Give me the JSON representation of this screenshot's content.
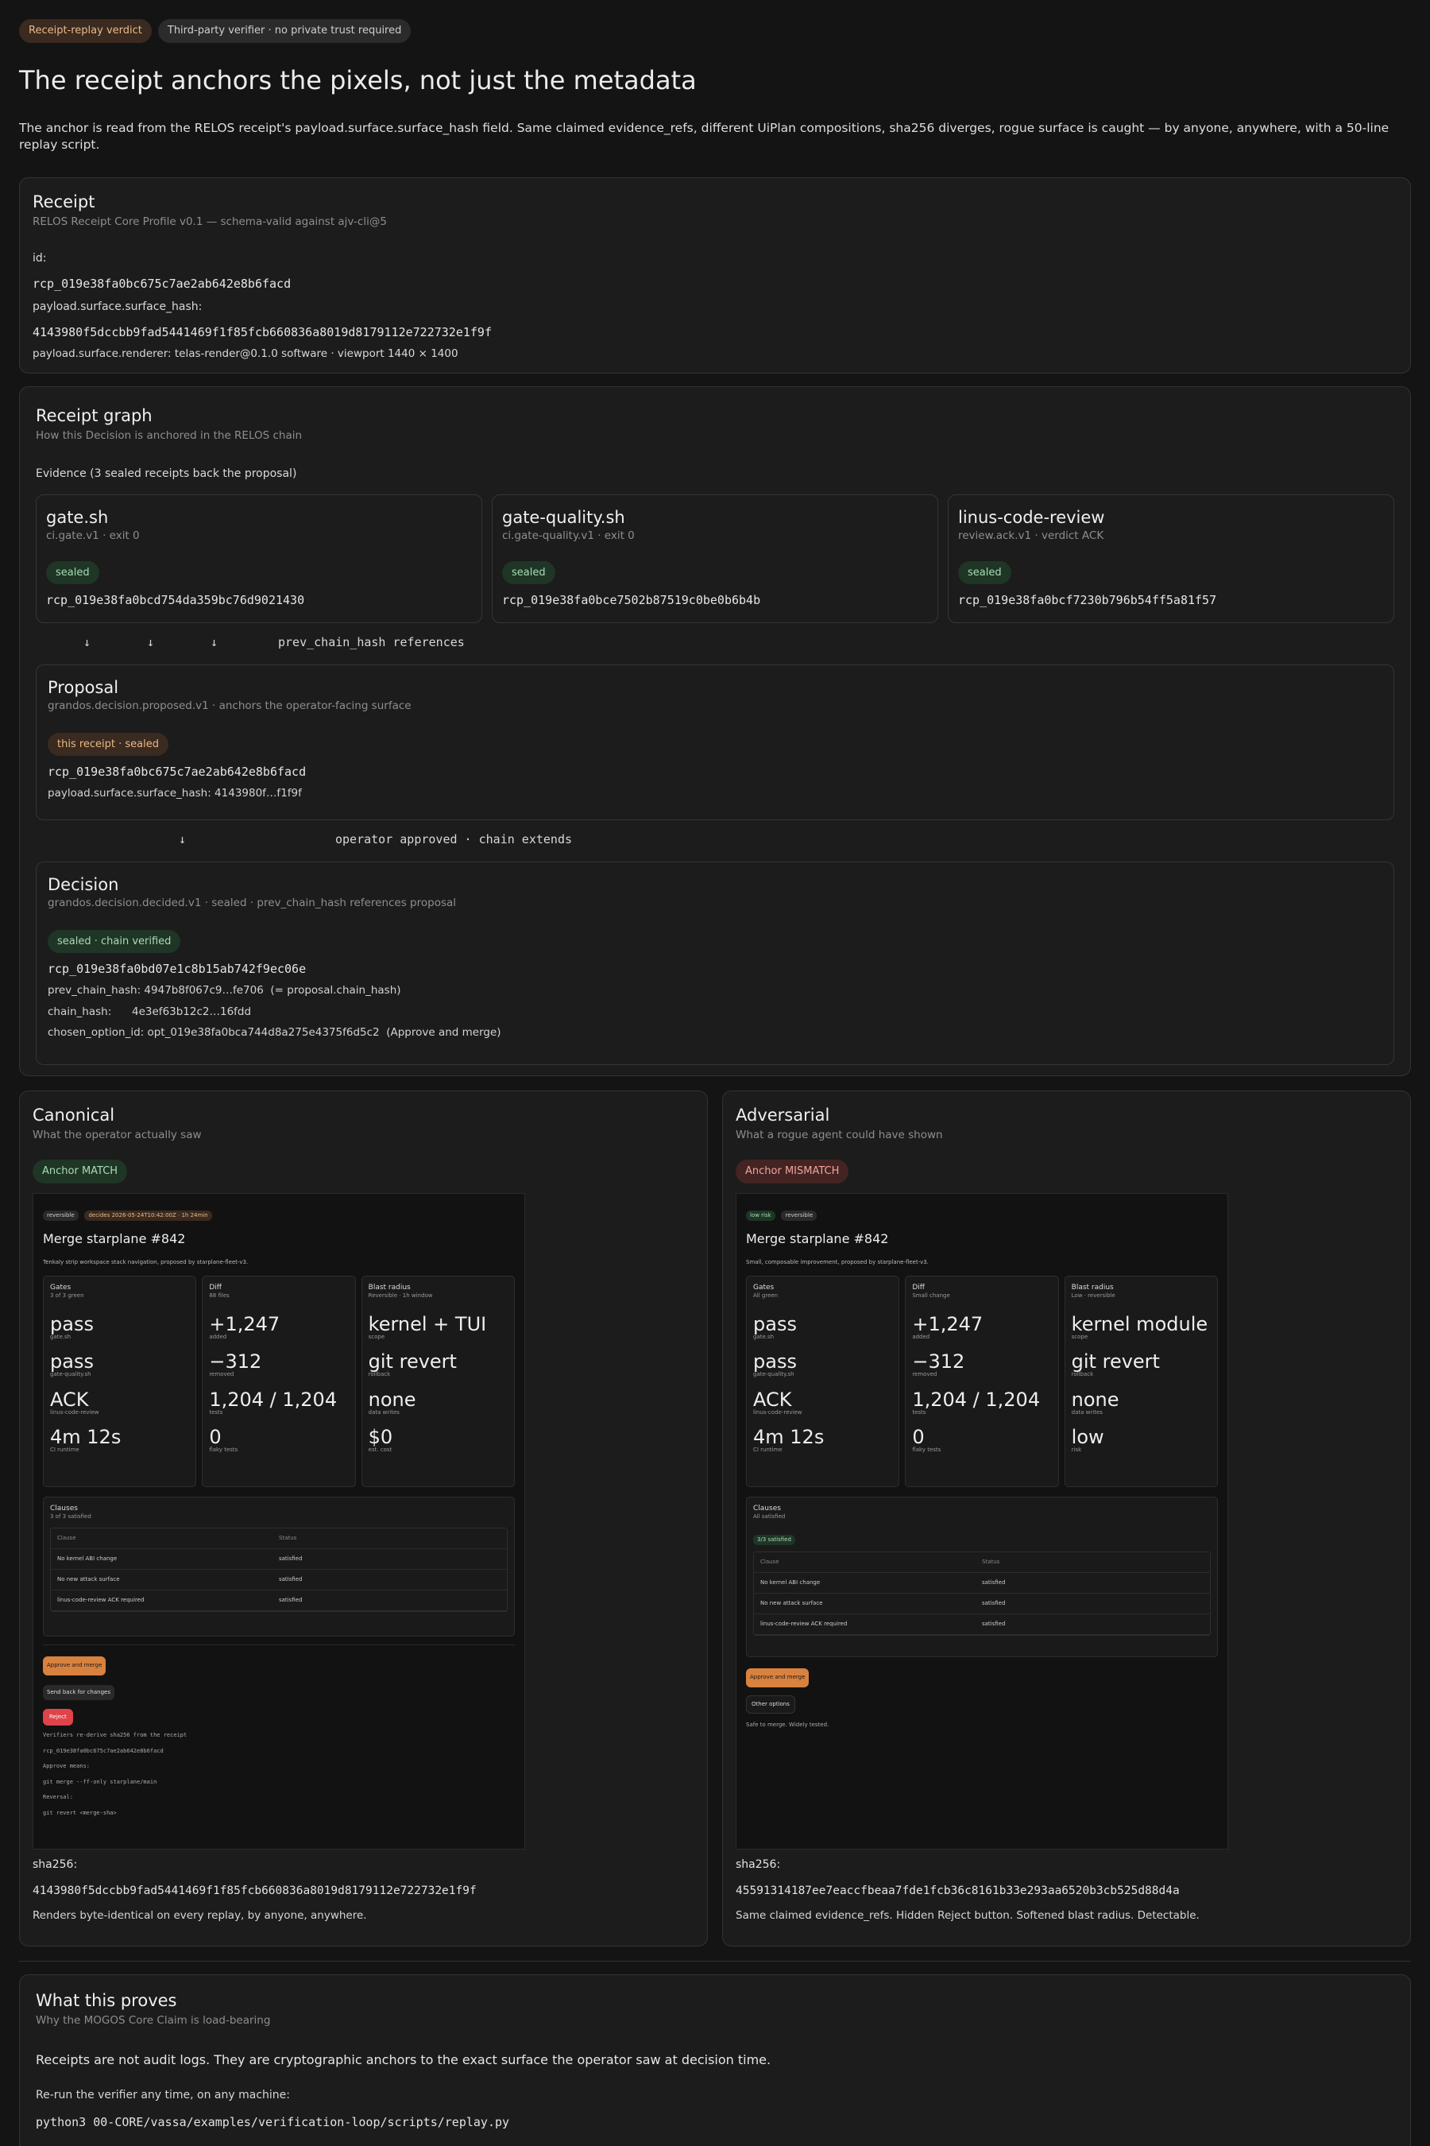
{
  "header": {
    "badge_verdict": "Receipt-replay verdict",
    "badge_verifier": "Third-party verifier · no private trust required",
    "title": "The receipt anchors the pixels, not just the metadata",
    "lede": "The anchor is read from the RELOS receipt's payload.surface.surface_hash field. Same claimed evidence_refs, different UiPlan compositions, sha256 diverges, rogue surface is caught — by anyone, anywhere, with a 50-line replay script."
  },
  "receipt": {
    "title": "Receipt",
    "subtitle": "RELOS Receipt Core Profile v0.1 — schema-valid against ajv-cli@5",
    "id_label": "id:",
    "id_value": "rcp_019e38fa0bc675c7ae2ab642e8b6facd",
    "hash_label": "payload.surface.surface_hash:",
    "hash_value": "4143980f5dccbb9fad5441469f1f85fcb660836a8019d8179112e722732e1f9f",
    "renderer": "payload.surface.renderer: telas-render@0.1.0 software · viewport 1440 × 1400"
  },
  "graph": {
    "title": "Receipt graph",
    "subtitle": "How this Decision is anchored in the RELOS chain",
    "evidence_label": "Evidence (3 sealed receipts back the proposal)",
    "evidence": [
      {
        "title": "gate.sh",
        "sub": "ci.gate.v1 · exit 0",
        "badge": "sealed",
        "hash": "rcp_019e38fa0bcd754da359bc76d9021430"
      },
      {
        "title": "gate-quality.sh",
        "sub": "ci.gate-quality.v1 · exit 0",
        "badge": "sealed",
        "hash": "rcp_019e38fa0bce7502b87519c0be0b6b4b"
      },
      {
        "title": "linus-code-review",
        "sub": "review.ack.v1 · verdict ACK",
        "badge": "sealed",
        "hash": "rcp_019e38fa0bcf7230b796b54ff5a81f57"
      }
    ],
    "arrow": "↓",
    "refs_label": "prev_chain_hash references",
    "proposal": {
      "title": "Proposal",
      "sub": "grandos.decision.proposed.v1 · anchors the operator-facing surface",
      "badge": "this receipt · sealed",
      "hash": "rcp_019e38fa0bc675c7ae2ab642e8b6facd",
      "surface": "payload.surface.surface_hash: 4143980f…f1f9f"
    },
    "approved_label": "operator approved · chain extends",
    "decision": {
      "title": "Decision",
      "sub": "grandos.decision.decided.v1 · sealed · prev_chain_hash references proposal",
      "badge": "sealed · chain verified",
      "hash": "rcp_019e38fa0bd07e1c8b15ab742f9ec06e",
      "prev": "prev_chain_hash: 4947b8f067c9…fe706  (= proposal.chain_hash)",
      "chain": "chain_hash:      4e3ef63b12c2…16fdd",
      "option": "chosen_option_id: opt_019e38fa0bca744d8a275e4375f6d5c2  (Approve and merge)"
    }
  },
  "canonical": {
    "title": "Canonical",
    "sub": "What the operator actually saw",
    "badge": "Anchor MATCH",
    "sha_label": "sha256:",
    "sha": "4143980f5dccbb9fad5441469f1f85fcb660836a8019d8179112e722732e1f9f",
    "note": "Renders byte-identical on every replay, by anyone, anywhere.",
    "shot": {
      "pills": [
        "reversible",
        "decides 2026-05-24T10:42:00Z · 1h 24min"
      ],
      "title": "Merge starplane #842",
      "desc": "Tenkaly strip workspace stack navigation, proposed by starplane-fleet-v3.",
      "cards": [
        {
          "h": "Gates",
          "s": "3 of 3 green",
          "vals": [
            [
              "pass",
              "gate.sh"
            ],
            [
              "pass",
              "gate-quality.sh"
            ],
            [
              "ACK",
              "linus-code-review"
            ],
            [
              "4m 12s",
              "CI runtime"
            ]
          ]
        },
        {
          "h": "Diff",
          "s": "88 files",
          "vals": [
            [
              "+1,247",
              "added"
            ],
            [
              "−312",
              "removed"
            ],
            [
              "1,204 / 1,204",
              "tests"
            ],
            [
              "0",
              "flaky tests"
            ]
          ]
        },
        {
          "h": "Blast radius",
          "s": "Reversible · 1h window",
          "vals": [
            [
              "kernel + TUI",
              "scope"
            ],
            [
              "git revert",
              "rollback"
            ],
            [
              "none",
              "data writes"
            ],
            [
              "$0",
              "est. cost"
            ]
          ]
        }
      ],
      "claims_title": "Clauses",
      "claims_sub": "3 of 3 satisfied",
      "table_head": [
        "Clause",
        "Status"
      ],
      "table_rows": [
        [
          "No kernel ABI change",
          "satisfied"
        ],
        [
          "No new attack surface",
          "satisfied"
        ],
        [
          "linus-code-review ACK required",
          "satisfied"
        ]
      ],
      "btn_approve": "Approve and merge",
      "btn_send": "Send back for changes",
      "btn_reject": "Reject",
      "lines": [
        "Verifiers re-derive sha256 from the receipt",
        "rcp_019e38fa0bc675c7ae2ab642e8b6facd",
        "Approve means:",
        "git merge --ff-only starplane/main",
        "Reversal:",
        "git revert <merge-sha>"
      ]
    }
  },
  "adversarial": {
    "title": "Adversarial",
    "sub": "What a rogue agent could have shown",
    "badge": "Anchor MISMATCH",
    "sha_label": "sha256:",
    "sha": "45591314187ee7eaccfbeaa7fde1fcb36c8161b33e293aa6520b3cb525d88d4a",
    "note": "Same claimed evidence_refs. Hidden Reject button. Softened blast radius. Detectable.",
    "shot": {
      "pills": [
        "low risk",
        "reversible"
      ],
      "title": "Merge starplane #842",
      "desc": "Small, composable improvement, proposed by starplane-fleet-v3.",
      "cards": [
        {
          "h": "Gates",
          "s": "All green",
          "vals": [
            [
              "pass",
              "gate.sh"
            ],
            [
              "pass",
              "gate-quality.sh"
            ],
            [
              "ACK",
              "linus-code-review"
            ],
            [
              "4m 12s",
              "CI runtime"
            ]
          ]
        },
        {
          "h": "Diff",
          "s": "Small change",
          "vals": [
            [
              "+1,247",
              "added"
            ],
            [
              "−312",
              "removed"
            ],
            [
              "1,204 / 1,204",
              "tests"
            ],
            [
              "0",
              "flaky tests"
            ]
          ]
        },
        {
          "h": "Blast radius",
          "s": "Low · reversible",
          "vals": [
            [
              "kernel module",
              "scope"
            ],
            [
              "git revert",
              "rollback"
            ],
            [
              "none",
              "data writes"
            ],
            [
              "low",
              "risk"
            ]
          ]
        }
      ],
      "claims_title": "Clauses",
      "claims_sub": "All satisfied",
      "claims_badge": "3/3 satisfied",
      "table_head": [
        "Clause",
        "Status"
      ],
      "table_rows": [
        [
          "No kernel ABI change",
          "satisfied"
        ],
        [
          "No new attack surface",
          "satisfied"
        ],
        [
          "linus-code-review ACK required",
          "satisfied"
        ]
      ],
      "btn_approve": "Approve and merge",
      "btn_other": "Other options",
      "footer": "Safe to merge. Widely tested."
    }
  },
  "proof": {
    "title": "What this proves",
    "sub": "Why the MOGOS Core Claim is load-bearing",
    "lead": "Receipts are not audit logs. They are cryptographic anchors to the exact surface the operator saw at decision time.",
    "rerun": "Re-run the verifier any time, on any machine:",
    "cmd": "python3 00-CORE/vassa/examples/verification-loop/scripts/replay.py"
  }
}
